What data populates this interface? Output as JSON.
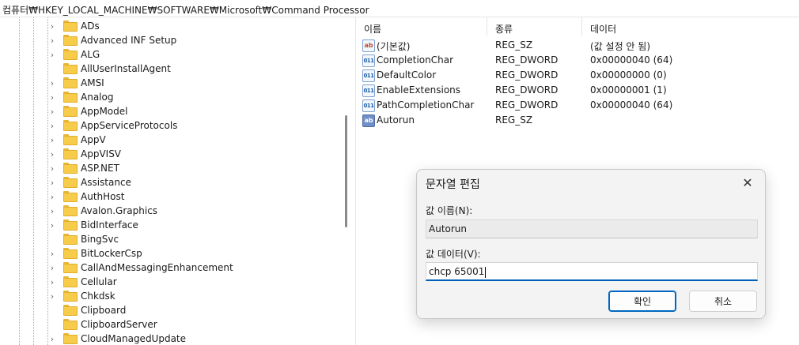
{
  "address_path": "컴퓨터₩HKEY_LOCAL_MACHINE₩SOFTWARE₩Microsoft₩Command Processor",
  "tree": {
    "items": [
      {
        "label": "ADs",
        "expandable": true
      },
      {
        "label": "Advanced INF Setup",
        "expandable": true
      },
      {
        "label": "ALG",
        "expandable": true
      },
      {
        "label": "AllUserInstallAgent",
        "expandable": false
      },
      {
        "label": "AMSI",
        "expandable": true
      },
      {
        "label": "Analog",
        "expandable": true
      },
      {
        "label": "AppModel",
        "expandable": true
      },
      {
        "label": "AppServiceProtocols",
        "expandable": true
      },
      {
        "label": "AppV",
        "expandable": true
      },
      {
        "label": "AppVISV",
        "expandable": true
      },
      {
        "label": "ASP.NET",
        "expandable": true
      },
      {
        "label": "Assistance",
        "expandable": true
      },
      {
        "label": "AuthHost",
        "expandable": true
      },
      {
        "label": "Avalon.Graphics",
        "expandable": true
      },
      {
        "label": "BidInterface",
        "expandable": true
      },
      {
        "label": "BingSvc",
        "expandable": false
      },
      {
        "label": "BitLockerCsp",
        "expandable": true
      },
      {
        "label": "CallAndMessagingEnhancement",
        "expandable": true
      },
      {
        "label": "Cellular",
        "expandable": true
      },
      {
        "label": "Chkdsk",
        "expandable": true
      },
      {
        "label": "Clipboard",
        "expandable": false
      },
      {
        "label": "ClipboardServer",
        "expandable": false
      },
      {
        "label": "CloudManagedUpdate",
        "expandable": true
      }
    ]
  },
  "list": {
    "columns": {
      "name": "이름",
      "type": "종류",
      "data": "데이터"
    },
    "rows": [
      {
        "name": "(기본값)",
        "type": "REG_SZ",
        "data": "(값 설정 안 됨)",
        "icon": "string-value-icon",
        "icon_text": "ab"
      },
      {
        "name": "CompletionChar",
        "type": "REG_DWORD",
        "data": "0x00000040 (64)",
        "icon": "dword-value-icon",
        "icon_text": "011"
      },
      {
        "name": "DefaultColor",
        "type": "REG_DWORD",
        "data": "0x00000000 (0)",
        "icon": "dword-value-icon",
        "icon_text": "011"
      },
      {
        "name": "EnableExtensions",
        "type": "REG_DWORD",
        "data": "0x00000001 (1)",
        "icon": "dword-value-icon",
        "icon_text": "011"
      },
      {
        "name": "PathCompletionChar",
        "type": "REG_DWORD",
        "data": "0x00000040 (64)",
        "icon": "dword-value-icon",
        "icon_text": "011"
      },
      {
        "name": "Autorun",
        "type": "REG_SZ",
        "data": "",
        "icon": "string-value-icon",
        "icon_text": "ab"
      }
    ]
  },
  "dialog": {
    "title": "문자열 편집",
    "name_label": "값 이름(N):",
    "name_value": "Autorun",
    "data_label": "값 데이터(V):",
    "data_value": "chcp 65001",
    "ok_label": "확인",
    "cancel_label": "취소",
    "close_glyph": "✕"
  },
  "colors": {
    "accent": "#005fb8",
    "folder": "#f7cc4b"
  },
  "chevron_glyph": "›"
}
